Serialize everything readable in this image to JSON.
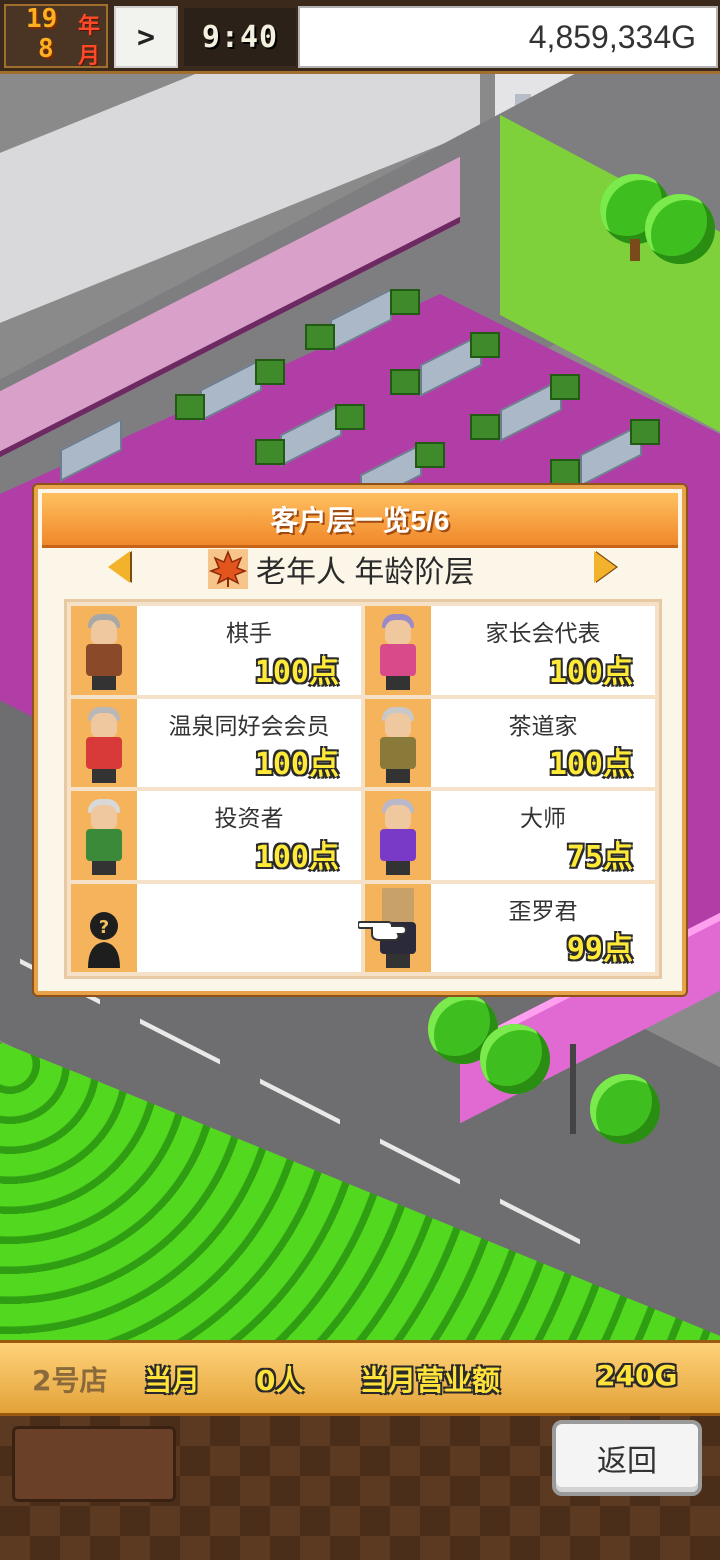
{
  "status_bar": {
    "year": "19",
    "year_unit": "年",
    "month": "8",
    "month_unit": "月",
    "speed_indicator": ">",
    "time": "9:40",
    "money": "4,859,334G"
  },
  "dialog": {
    "title": "客户层一览5/6",
    "category": "老年人 年龄阶层",
    "customers": [
      {
        "name": "棋手",
        "points": "100点",
        "hair": "#a8a8a8",
        "body": "#8a4a2a"
      },
      {
        "name": "家长会代表",
        "points": "100点",
        "hair": "#9a8ac8",
        "body": "#d84a8a"
      },
      {
        "name": "温泉同好会会员",
        "points": "100点",
        "hair": "#b8b8b8",
        "body": "#d83a3a"
      },
      {
        "name": "茶道家",
        "points": "100点",
        "hair": "#c8c8c8",
        "body": "#8a7a3a"
      },
      {
        "name": "投资者",
        "points": "100点",
        "hair": "#d8d8d8",
        "body": "#3a8a3a"
      },
      {
        "name": "大师",
        "points": "75点",
        "hair": "#b8b8c8",
        "body": "#7a3ac8"
      },
      {
        "name": "",
        "points": "",
        "hair": "",
        "body": ""
      },
      {
        "name": "歪罗君",
        "points": "99点",
        "hair": "#c8a06a",
        "body": "#2a2a3a"
      }
    ]
  },
  "bottom_bar": {
    "store": "2号店",
    "month_label": "当月",
    "visitors": "0人",
    "sales_label": "当月营业额",
    "sales_value": "240G"
  },
  "buttons": {
    "back_label": "返回"
  }
}
